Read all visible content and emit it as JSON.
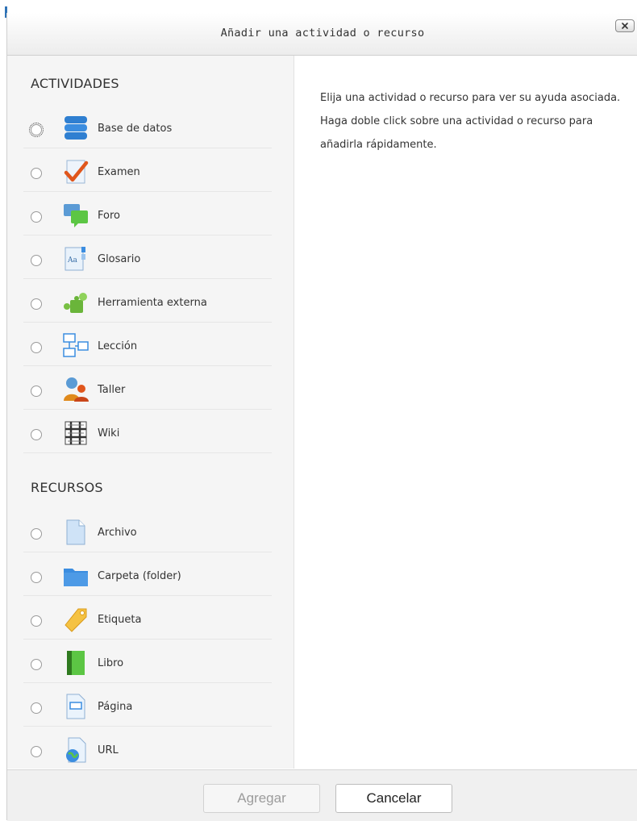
{
  "dialog": {
    "title": "Añadir una actividad o recurso",
    "close_label": "x"
  },
  "sections": {
    "activities_title": "ACTIVIDADES",
    "resources_title": "RECURSOS"
  },
  "activities": [
    {
      "label": "Base de datos",
      "icon": "database-icon"
    },
    {
      "label": "Examen",
      "icon": "quiz-icon"
    },
    {
      "label": "Foro",
      "icon": "forum-icon"
    },
    {
      "label": "Glosario",
      "icon": "glossary-icon"
    },
    {
      "label": "Herramienta externa",
      "icon": "external-tool-icon"
    },
    {
      "label": "Lección",
      "icon": "lesson-icon"
    },
    {
      "label": "Taller",
      "icon": "workshop-icon"
    },
    {
      "label": "Wiki",
      "icon": "wiki-icon"
    }
  ],
  "resources": [
    {
      "label": "Archivo",
      "icon": "file-icon"
    },
    {
      "label": "Carpeta (folder)",
      "icon": "folder-icon"
    },
    {
      "label": "Etiqueta",
      "icon": "label-icon"
    },
    {
      "label": "Libro",
      "icon": "book-icon"
    },
    {
      "label": "Página",
      "icon": "page-icon"
    },
    {
      "label": "URL",
      "icon": "url-icon"
    }
  ],
  "help": {
    "text": "Elija una actividad o recurso para ver su ayuda asociada. Haga doble click sobre una actividad o recurso para añadirla rápidamente."
  },
  "footer": {
    "add_label": "Agregar",
    "cancel_label": "Cancelar"
  },
  "colors": {
    "accent": "#2f73b6",
    "panel_bg": "#f5f5f5"
  }
}
